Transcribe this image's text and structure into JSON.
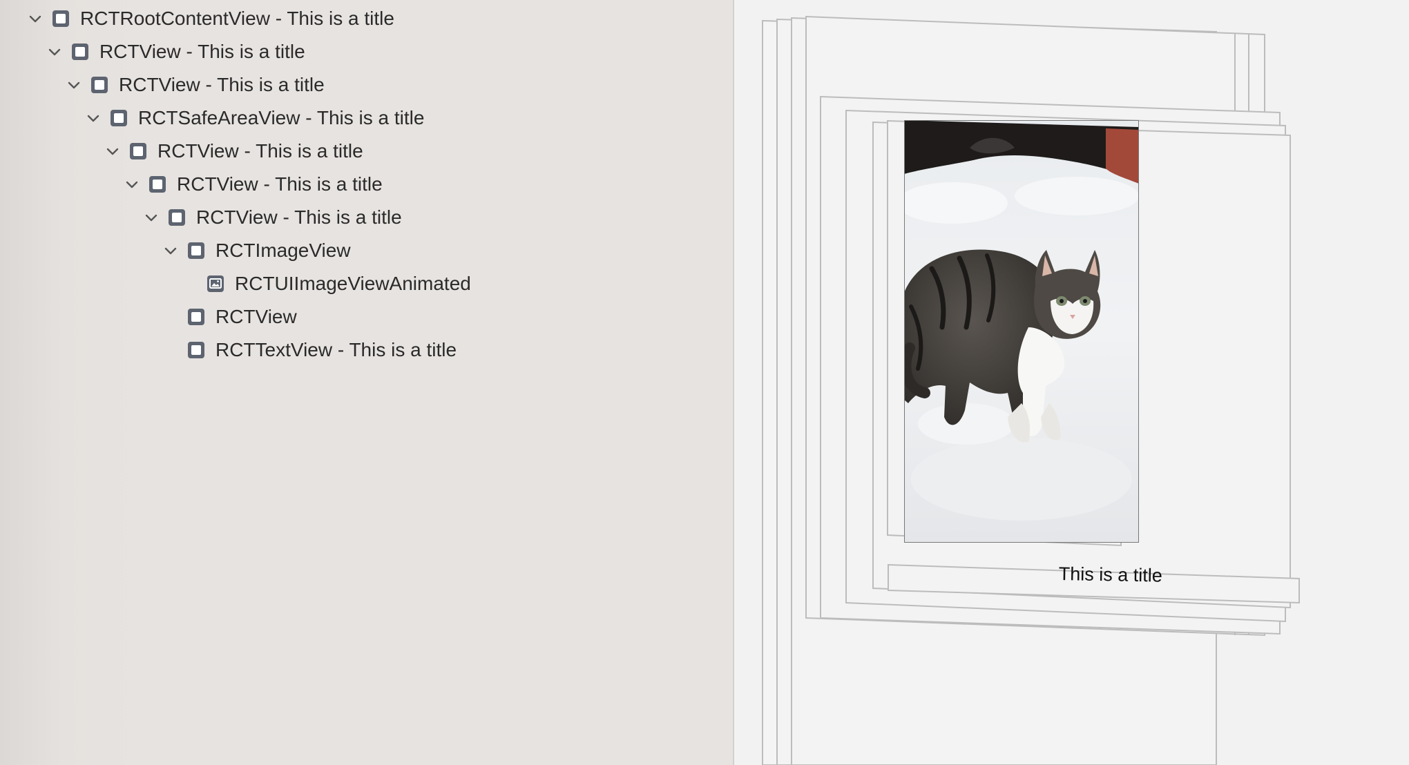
{
  "hierarchy": {
    "nodes": [
      {
        "label": "RCTRootContentView - This is a title",
        "icon": "view-box-icon",
        "expanded": true
      },
      {
        "label": "RCTView - This is a title",
        "icon": "view-box-icon",
        "expanded": true
      },
      {
        "label": "RCTView - This is a title",
        "icon": "view-box-icon",
        "expanded": true
      },
      {
        "label": "RCTSafeAreaView - This is a title",
        "icon": "view-box-icon",
        "expanded": true
      },
      {
        "label": "RCTView - This is a title",
        "icon": "view-box-icon",
        "expanded": true
      },
      {
        "label": "RCTView - This is a title",
        "icon": "view-box-icon",
        "expanded": true
      },
      {
        "label": "RCTView - This is a title",
        "icon": "view-box-icon",
        "expanded": true
      },
      {
        "label": "RCTImageView",
        "icon": "view-box-icon",
        "expanded": true
      },
      {
        "label": "RCTUIImageViewAnimated",
        "icon": "image-view-icon",
        "expanded": false
      },
      {
        "label": "RCTView",
        "icon": "view-box-icon",
        "expanded": false
      },
      {
        "label": "RCTTextView - This is a title",
        "icon": "view-box-icon",
        "expanded": false
      }
    ]
  },
  "canvas": {
    "title_text": "This is a title",
    "image_subject": "kitten-in-snow-photo"
  },
  "colors": {
    "navigator_bg": "#e7e3e0",
    "canvas_bg": "#f2f2f2",
    "frame_stroke": "#b9b9b9",
    "icon_color": "#5d6470",
    "text_color": "#2a2a2a"
  }
}
